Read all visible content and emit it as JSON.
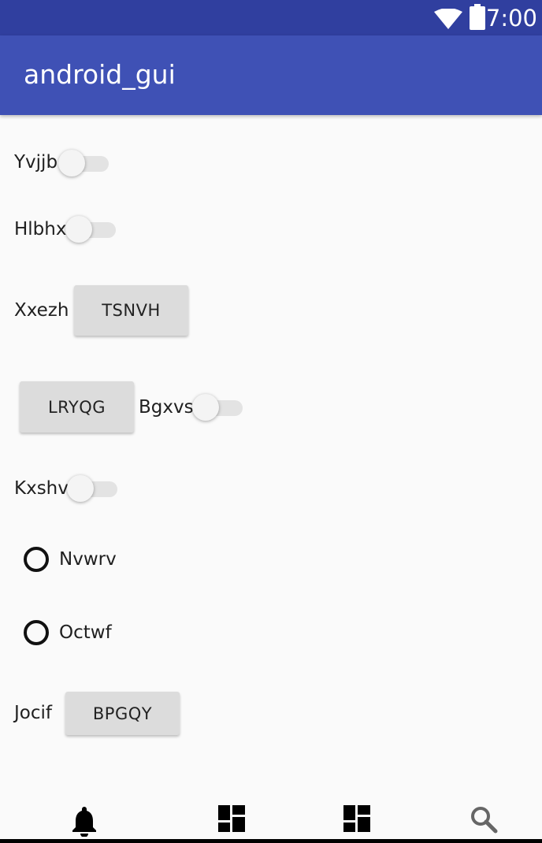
{
  "status_bar": {
    "time": "7:00",
    "icons": [
      "wifi-icon",
      "battery-icon"
    ]
  },
  "app_bar": {
    "title": "android_gui"
  },
  "rows": {
    "switch1_label": "Yvjjb",
    "switch2_label": "Hlbhx",
    "row3_label": "Xxezh",
    "row3_button": "TSNVH",
    "row4_button": "LRYQG",
    "row4_switch_label": "Bgxvs",
    "switch5_label": "Kxshv",
    "radio1_label": "Nvwrv",
    "radio2_label": "Octwf",
    "row8_label": "Jocif",
    "row8_button": "BPGQY"
  },
  "bottom_nav": {
    "items": [
      "bell-icon",
      "dashboard-icon",
      "dashboard-icon",
      "search-icon"
    ]
  },
  "colors": {
    "status_bar": "#303f9f",
    "app_bar": "#3f51b5",
    "background": "#fafafa",
    "button": "#dcdcdc"
  }
}
